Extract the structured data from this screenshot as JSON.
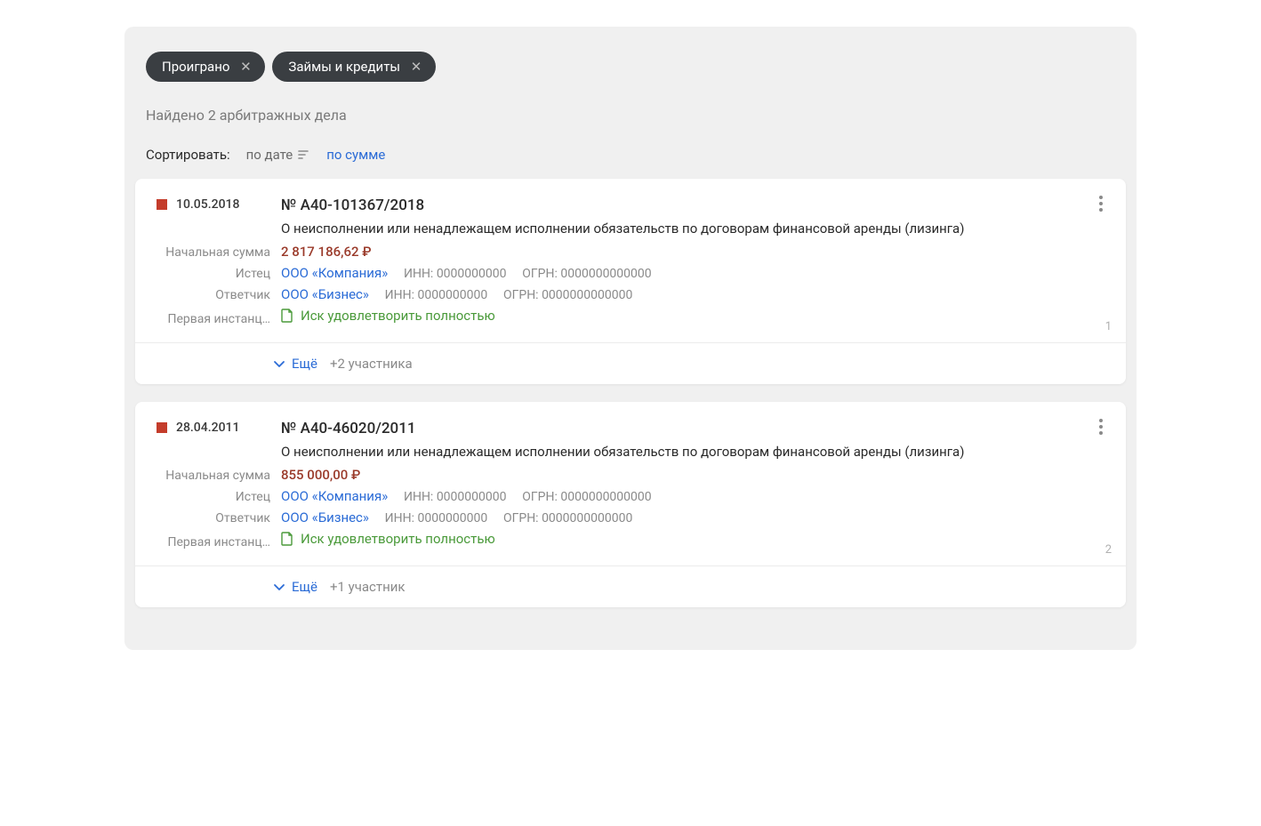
{
  "filters": [
    {
      "label": "Проиграно"
    },
    {
      "label": "Займы и кредиты"
    }
  ],
  "found_text": "Найдено 2 арбитражных дела",
  "sort": {
    "label": "Сортировать:",
    "active": "по дате",
    "other": "по сумме"
  },
  "labels": {
    "initial_sum": "Начальная сумма",
    "plaintiff": "Истец",
    "defendant": "Ответчик",
    "first_instance": "Первая инстанц…",
    "more": "Ещё",
    "inn_prefix": "ИНН:",
    "ogrn_prefix": "ОГРН:"
  },
  "cases": [
    {
      "status_color": "#c43c2b",
      "date": "10.05.2018",
      "number": "№ А40-101367/2018",
      "description": "О неисполнении или ненадлежащем исполнении обязательств по договорам финансовой аренды (лизинга)",
      "amount": "2 817 186,62 ₽",
      "plaintiff": {
        "name": "ООО «Компания»",
        "inn": "0000000000",
        "ogrn": "0000000000000"
      },
      "defendant": {
        "name": "ООО «Бизнес»",
        "inn": "0000000000",
        "ogrn": "0000000000000"
      },
      "verdict": "Иск удовлетворить полностью",
      "more_count": "+2 участника",
      "index": "1"
    },
    {
      "status_color": "#c43c2b",
      "date": "28.04.2011",
      "number": "№ А40-46020/2011",
      "description": "О неисполнении или ненадлежащем исполнении обязательств по договорам финансовой аренды (лизинга)",
      "amount": "855 000,00 ₽",
      "plaintiff": {
        "name": "ООО «Компания»",
        "inn": "0000000000",
        "ogrn": "0000000000000"
      },
      "defendant": {
        "name": "ООО «Бизнес»",
        "inn": "0000000000",
        "ogrn": "0000000000000"
      },
      "verdict": "Иск удовлетворить полностью",
      "more_count": "+1 участник",
      "index": "2"
    }
  ]
}
